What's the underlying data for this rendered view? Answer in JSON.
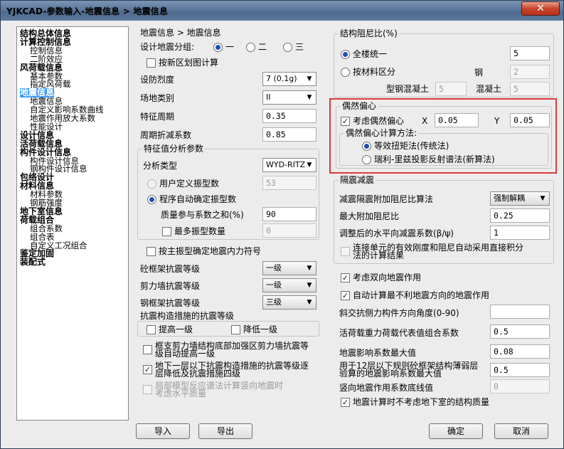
{
  "window": {
    "title": "YJKCAD-参数输入-地震信息 > 地震信息",
    "close_glyph": "✕"
  },
  "tree": {
    "items": [
      {
        "label": "结构总体信息",
        "level": 0
      },
      {
        "label": "计算控制信息",
        "level": 0
      },
      {
        "label": "控制信息",
        "level": 1
      },
      {
        "label": "二阶效应",
        "level": 1
      },
      {
        "label": "风荷载信息",
        "level": 0
      },
      {
        "label": "基本参数",
        "level": 1
      },
      {
        "label": "指定风荷载",
        "level": 1
      },
      {
        "label": "地震信息",
        "level": 0,
        "selected": true
      },
      {
        "label": "地震信息",
        "level": 1
      },
      {
        "label": "自定义影响系数曲线",
        "level": 1
      },
      {
        "label": "地震作用放大系数",
        "level": 1
      },
      {
        "label": "性能设计",
        "level": 1
      },
      {
        "label": "设计信息",
        "level": 0
      },
      {
        "label": "活荷载信息",
        "level": 0
      },
      {
        "label": "构件设计信息",
        "level": 0
      },
      {
        "label": "构件设计信息",
        "level": 1
      },
      {
        "label": "钢构件设计信息",
        "level": 1
      },
      {
        "label": "包络设计",
        "level": 0
      },
      {
        "label": "材料信息",
        "level": 0
      },
      {
        "label": "材料参数",
        "level": 1
      },
      {
        "label": "钢筋强度",
        "level": 1
      },
      {
        "label": "地下室信息",
        "level": 0
      },
      {
        "label": "荷载组合",
        "level": 0
      },
      {
        "label": "组合系数",
        "level": 1
      },
      {
        "label": "组合表",
        "level": 1
      },
      {
        "label": "自定义工况组合",
        "level": 1
      },
      {
        "label": "鉴定加固",
        "level": 0
      },
      {
        "label": "装配式",
        "level": 0
      }
    ]
  },
  "left": {
    "breadcrumb": "地震信息 > 地震信息",
    "design_group_label": "设计地震分组:",
    "design_group_options": [
      "一",
      "二",
      "三"
    ],
    "new_zoning_label": "按新区划图计算",
    "intensity_label": "设防烈度",
    "intensity_value": "7 (0.1g)",
    "site_label": "场地类别",
    "site_value": "II",
    "period_label": "特征周期",
    "period_value": "0.35",
    "reduction_label": "周期折减系数",
    "reduction_value": "0.85",
    "eigen_group_title": "特征值分析参数",
    "analysis_type_label": "分析类型",
    "analysis_type_value": "WYD-RITZ",
    "user_modes_label": "用户定义振型数",
    "user_modes_value": "53",
    "auto_modes_label": "程序自动确定振型数",
    "mass_sum_label": "质量参与系数之和(%)",
    "mass_sum_value": "90",
    "max_modes_label": "最多振型数量",
    "max_modes_value": "0",
    "main_mode_label": "按主振型确定地震内力符号",
    "frame_grade_label": "砼框架抗震等级",
    "frame_grade_value": "一级",
    "wall_grade_label": "剪力墙抗震等级",
    "wall_grade_value": "一级",
    "steel_grade_label": "钢框架抗震等级",
    "steel_grade_value": "三级",
    "measure_title": "抗震构造措施的抗震等级",
    "raise_label": "提高一级",
    "lower_label": "降低一级",
    "frame_shear_line1": "框支剪力墙结构底部加强区剪力墙抗震等",
    "frame_shear_line2": "级自动提高一级",
    "basement_line1": "地下一层以下抗震构造措施的抗震等级逐",
    "basement_line2": "层降低及抗震措施四级",
    "local_model_line1": "局部模型反应谱法计算竖向地震时",
    "local_model_line2": "考虑水平质量"
  },
  "right": {
    "damping_title": "结构阻尼比(%)",
    "whole_building_label": "全楼统一",
    "whole_building_value": "5",
    "by_material_label": "按材料区分",
    "steel_label": "钢",
    "steel_value": "2",
    "steel_concrete_label": "型钢混凝土",
    "steel_concrete_value": "5",
    "concrete_label": "混凝土",
    "concrete_value": "5",
    "accidental_title": "偶然偏心",
    "consider_accidental_label": "考虑偶然偏心",
    "x_label": "X",
    "x_value": "0.05",
    "y_label": "Y",
    "y_value": "0.05",
    "method_title": "偶然偏心计算方法:",
    "method_option1": "等效扭矩法(传统法)",
    "method_option2": "瑞利-里兹投影反射谱法(新算法)",
    "isolation_title": "隔震减震",
    "iso_method_label": "减震隔震附加阻尼比算法",
    "iso_method_value": "强制解耦",
    "max_damping_label": "最大附加阻尼比",
    "max_damping_value": "0.25",
    "adjusted_coef_label": "调整后的水平向减震系数(β/ψ)",
    "adjusted_coef_value": "1",
    "connect_line1": "连接单元的有效刚度和阻尼自动采用直接积分",
    "connect_line2": "法的计算结果",
    "bidirectional_label": "考虑双向地震作用",
    "auto_worst_label": "自动计算最不利地震方向的地震作用",
    "oblique_label": "斜交抗侧力构件方向角度(0-90)",
    "oblique_value": "",
    "live_load_label": "活荷载重力荷载代表值组合系数",
    "live_load_value": "0.5",
    "max_coef_label": "地震影响系数最大值",
    "max_coef_value": "0.08",
    "weak_line1": "用于12层以下规则砼框架结构薄弱层",
    "weak_line2": "验算的地震影响系数最大值",
    "weak_value": "0.5",
    "vertical_label": "竖向地震作用系数底线值",
    "vertical_value": "0",
    "basement_mass_label": "地震计算时不考虑地下室的结构质量"
  },
  "footer": {
    "import": "导入",
    "export": "导出",
    "ok": "确定",
    "cancel": "取消"
  },
  "icons": {
    "check": "✓",
    "dropdown": "▼"
  }
}
